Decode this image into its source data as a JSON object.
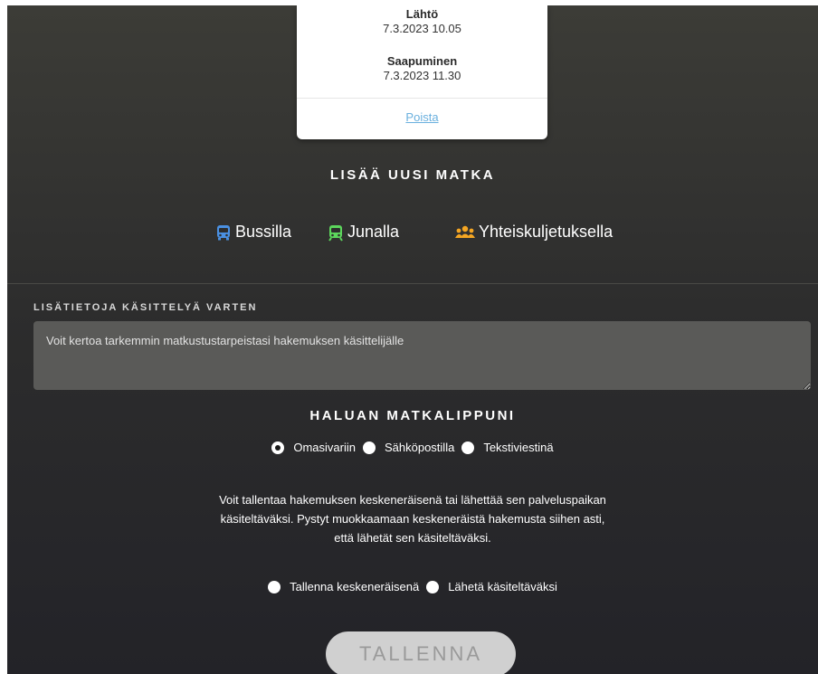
{
  "trip_card": {
    "departure_label": "Lähtö",
    "departure_value": "7.3.2023 10.05",
    "arrival_label": "Saapuminen",
    "arrival_value": "7.3.2023 11.30",
    "delete_link": "Poista"
  },
  "add_trip": {
    "heading": "LISÄÄ UUSI MATKA",
    "modes": [
      {
        "label": "Bussilla",
        "icon": "bus-icon",
        "color": "#4a90e2"
      },
      {
        "label": "Junalla",
        "icon": "train-icon",
        "color": "#5cd65c"
      },
      {
        "label": "Yhteiskuljetuksella",
        "icon": "group-icon",
        "color": "#f5a623"
      }
    ]
  },
  "extra_info": {
    "label": "LISÄTIETOJA KÄSITTELYÄ VARTEN",
    "placeholder": "Voit kertoa tarkemmin matkustustarpeistasi hakemuksen käsittelijälle"
  },
  "ticket": {
    "heading": "HALUAN MATKALIPPUNI",
    "options": [
      {
        "label": "Omasivariin",
        "checked": true
      },
      {
        "label": "Sähköpostilla",
        "checked": false
      },
      {
        "label": "Tekstiviestinä",
        "checked": false
      }
    ]
  },
  "help_text": {
    "line1": "Voit tallentaa hakemuksen keskeneräisenä tai lähettää sen palveluspaikan",
    "line2": "käsiteltäväksi. Pystyt muokkaamaan keskeneräistä hakemusta siihen asti,",
    "line3": "että lähetät sen käsiteltäväksi."
  },
  "submit_mode": {
    "options": [
      {
        "label": "Tallenna keskeneräisenä",
        "checked": false
      },
      {
        "label": "Lähetä käsiteltäväksi",
        "checked": false
      }
    ]
  },
  "save_button": "TALLENNA"
}
